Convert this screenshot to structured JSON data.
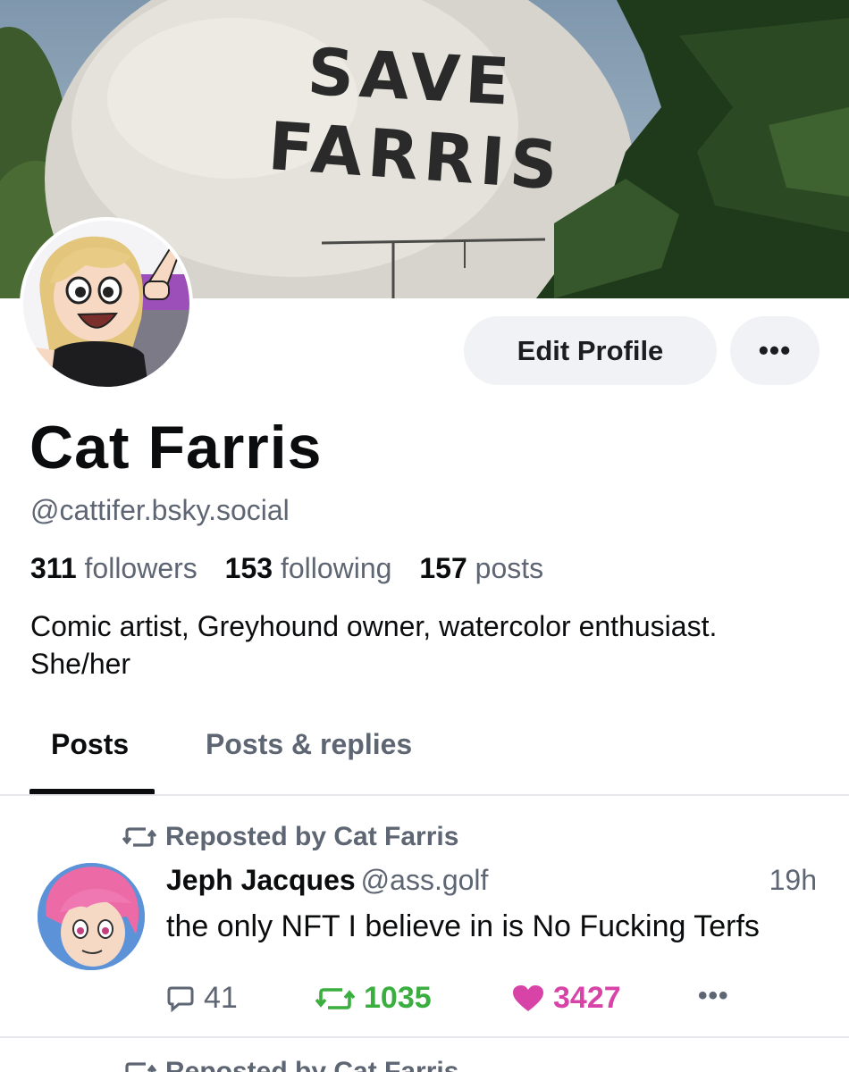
{
  "banner": {
    "sign_line1": "SAVE",
    "sign_line2": "FARRIS"
  },
  "profile": {
    "display_name": "Cat Farris",
    "handle": "@cattifer.bsky.social",
    "followers_count": "311",
    "followers_label": "followers",
    "following_count": "153",
    "following_label": "following",
    "posts_count": "157",
    "posts_label": "posts",
    "bio_line1": "Comic artist, Greyhound owner, watercolor enthusiast.",
    "bio_line2": "She/her"
  },
  "actions": {
    "edit_profile_label": "Edit Profile",
    "more_label": "•••"
  },
  "tabs": [
    {
      "label": "Posts",
      "active": true
    },
    {
      "label": "Posts & replies",
      "active": false
    }
  ],
  "feed": {
    "items": [
      {
        "repost_label": "Reposted by Cat Farris",
        "author_name": "Jeph Jacques",
        "author_handle": "@ass.golf",
        "time": "19h",
        "text": "the only NFT I believe in is No Fucking Terfs",
        "reply_count": "41",
        "repost_count": "1035",
        "like_count": "3427",
        "more_label": "•••"
      },
      {
        "repost_label": "Reposted by Cat Farris"
      }
    ]
  },
  "colors": {
    "accent_repost": "#3aae3e",
    "accent_like": "#d743a6",
    "muted_text": "#5e6573",
    "button_bg": "#f1f2f6"
  },
  "icons": {
    "repost": "repost-icon",
    "reply": "reply-icon",
    "like": "heart-icon",
    "more": "more-icon"
  }
}
